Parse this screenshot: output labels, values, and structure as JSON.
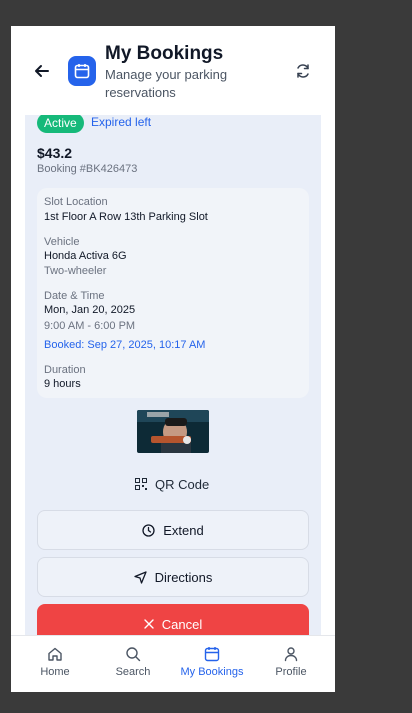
{
  "header": {
    "title": "My Bookings",
    "subtitle": "Manage your parking reservations"
  },
  "booking": {
    "status": "Active",
    "expiry": "Expired left",
    "price": "$43.2",
    "booking_id": "Booking #BK426473",
    "slot_label": "Slot Location",
    "slot_value": "1st Floor A Row 13th Parking Slot",
    "vehicle_label": "Vehicle",
    "vehicle_name": "Honda Activa 6G",
    "vehicle_type": "Two-wheeler",
    "datetime_label": "Date & Time",
    "date": "Mon, Jan 20, 2025",
    "time": "9:00 AM - 6:00 PM",
    "booked_at": "Booked: Sep 27, 2025, 10:17 AM",
    "duration_label": "Duration",
    "duration_value": "9 hours"
  },
  "actions": {
    "qr": "QR Code",
    "extend": "Extend",
    "directions": "Directions",
    "cancel": "Cancel"
  },
  "nav": {
    "items": [
      {
        "label": "Home",
        "icon": "home-icon"
      },
      {
        "label": "Search",
        "icon": "search-icon"
      },
      {
        "label": "My Bookings",
        "icon": "calendar-icon",
        "active": true
      },
      {
        "label": "Profile",
        "icon": "user-icon"
      }
    ]
  },
  "colors": {
    "accent": "#2563eb",
    "active_badge": "#16b97a",
    "cancel": "#ef4444",
    "card_bg": "#e9eef8"
  }
}
